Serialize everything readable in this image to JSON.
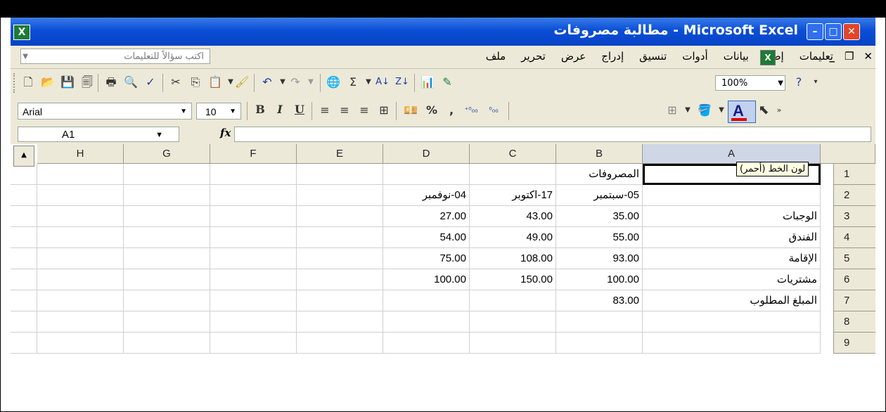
{
  "window": {
    "title": "Microsoft Excel - مطالبة مصروفات",
    "icon": "excel-icon"
  },
  "menubar": {
    "help_question": "اكتب سؤالاً للتعليمات",
    "items": [
      "ملف",
      "تحرير",
      "عرض",
      "إدراج",
      "تنسيق",
      "أدوات",
      "بيانات",
      "إطار",
      "تعليمات"
    ]
  },
  "toolbar": {
    "zoom": "100%"
  },
  "formatting": {
    "font": "Arial",
    "size": "10",
    "bold": "B",
    "italic": "I",
    "underline": "U",
    "percent": "%",
    "comma": ",",
    "inc_decimal": "⁺⁰₀₀",
    "dec_decimal": "⁰₀₀",
    "font_color": "A",
    "font_color_value": "#e00000",
    "tooltip": "لون الخط (أحمر)"
  },
  "formula": {
    "name_box": "A1",
    "fx": "fx",
    "value": ""
  },
  "sheet": {
    "columns": [
      "H",
      "G",
      "F",
      "E",
      "D",
      "C",
      "B",
      "A"
    ],
    "rows": [
      "1",
      "2",
      "3",
      "4",
      "5",
      "6",
      "7",
      "8",
      "9"
    ],
    "cells": {
      "B1": "المصروفات",
      "B2": "05-سبتمبر",
      "C2": "17-اكتوبر",
      "D2": "04-نوفمبر",
      "A3": "الوجبات",
      "B3": "35.00",
      "C3": "43.00",
      "D3": "27.00",
      "A4": "الفندق",
      "B4": "55.00",
      "C4": "49.00",
      "D4": "54.00",
      "A5": "الإقامة",
      "B5": "93.00",
      "C5": "108.00",
      "D5": "75.00",
      "A6": "مشتريات",
      "B6": "100.00",
      "C6": "150.00",
      "D6": "100.00",
      "A7": "المبلغ المطلوب",
      "B7": "83.00"
    }
  }
}
